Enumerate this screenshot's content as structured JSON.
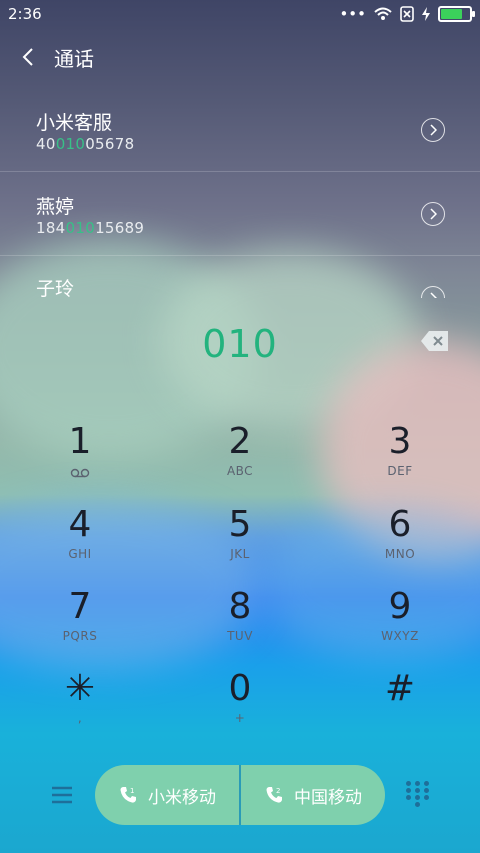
{
  "status_bar": {
    "time": "2:36"
  },
  "header": {
    "title": "通话"
  },
  "results": [
    {
      "name": "小米客服",
      "number_prefix": "40",
      "number_match": "010",
      "number_suffix": "05678"
    },
    {
      "name": "燕婷",
      "number_prefix": "184",
      "number_match": "010",
      "number_suffix": "15689"
    },
    {
      "name": "子玲",
      "number_prefix": "",
      "number_match": "",
      "number_suffix": ""
    }
  ],
  "dialer": {
    "value": "010"
  },
  "keypad": [
    {
      "digit": "1",
      "letters": ""
    },
    {
      "digit": "2",
      "letters": "ABC"
    },
    {
      "digit": "3",
      "letters": "DEF"
    },
    {
      "digit": "4",
      "letters": "GHI"
    },
    {
      "digit": "5",
      "letters": "JKL"
    },
    {
      "digit": "6",
      "letters": "MNO"
    },
    {
      "digit": "7",
      "letters": "PQRS"
    },
    {
      "digit": "8",
      "letters": "TUV"
    },
    {
      "digit": "9",
      "letters": "WXYZ"
    },
    {
      "digit": "✳",
      "letters": ","
    },
    {
      "digit": "0",
      "letters": "+"
    },
    {
      "digit": "#",
      "letters": ""
    }
  ],
  "bottom": {
    "sim1_label": "小米移动",
    "sim2_label": "中国移动"
  },
  "colors": {
    "match_highlight": "#38c088",
    "call_button": "#7fd0ad"
  },
  "icons": [
    "wifi-icon",
    "sim-off-icon",
    "battery-icon",
    "back-icon",
    "chevron-right-icon",
    "backspace-icon",
    "voicemail-icon",
    "menu-icon",
    "sim-call-icon",
    "dialpad-icon"
  ]
}
